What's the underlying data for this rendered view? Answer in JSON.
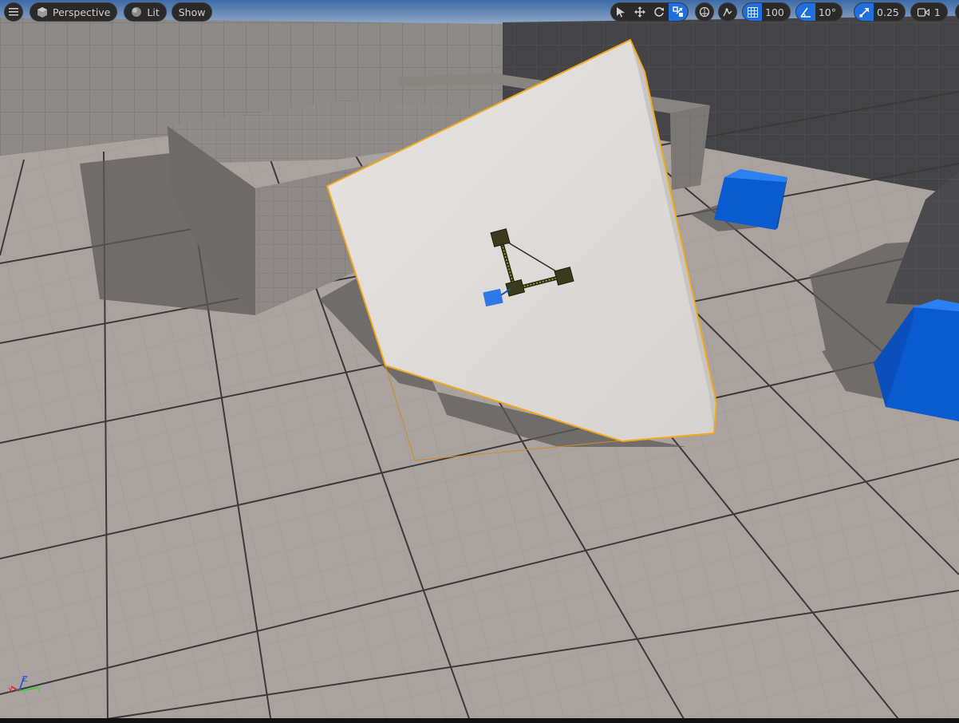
{
  "viewport": {
    "view_mode_label": "Perspective",
    "lighting_label": "Lit",
    "show_label": "Show",
    "grid_snap_value": "100",
    "rotation_snap_value": "10°",
    "scale_snap_value": "0.25",
    "camera_speed_value": "1"
  },
  "scene": {
    "selected_object": "plane-mesh",
    "selection_color": "#f0a81c",
    "floor_color": "#a8a19d",
    "wall_color": "#454546",
    "cube_color": "#0a5cd0"
  },
  "icons": {
    "menu": "hamburger-menu-icon",
    "perspective": "cube-icon",
    "lit": "sphere-icon",
    "select": "arrow-cursor-icon",
    "translate": "move-icon",
    "rotate": "rotate-icon",
    "scale": "scale-icon",
    "surface_snap": "surface-snap-icon",
    "grid_snap": "grid-icon",
    "rotation_snap": "angle-icon",
    "scale_snap": "diagonal-arrow-icon",
    "camera_speed": "camera-icon",
    "layout": "viewport-layout-icon"
  }
}
